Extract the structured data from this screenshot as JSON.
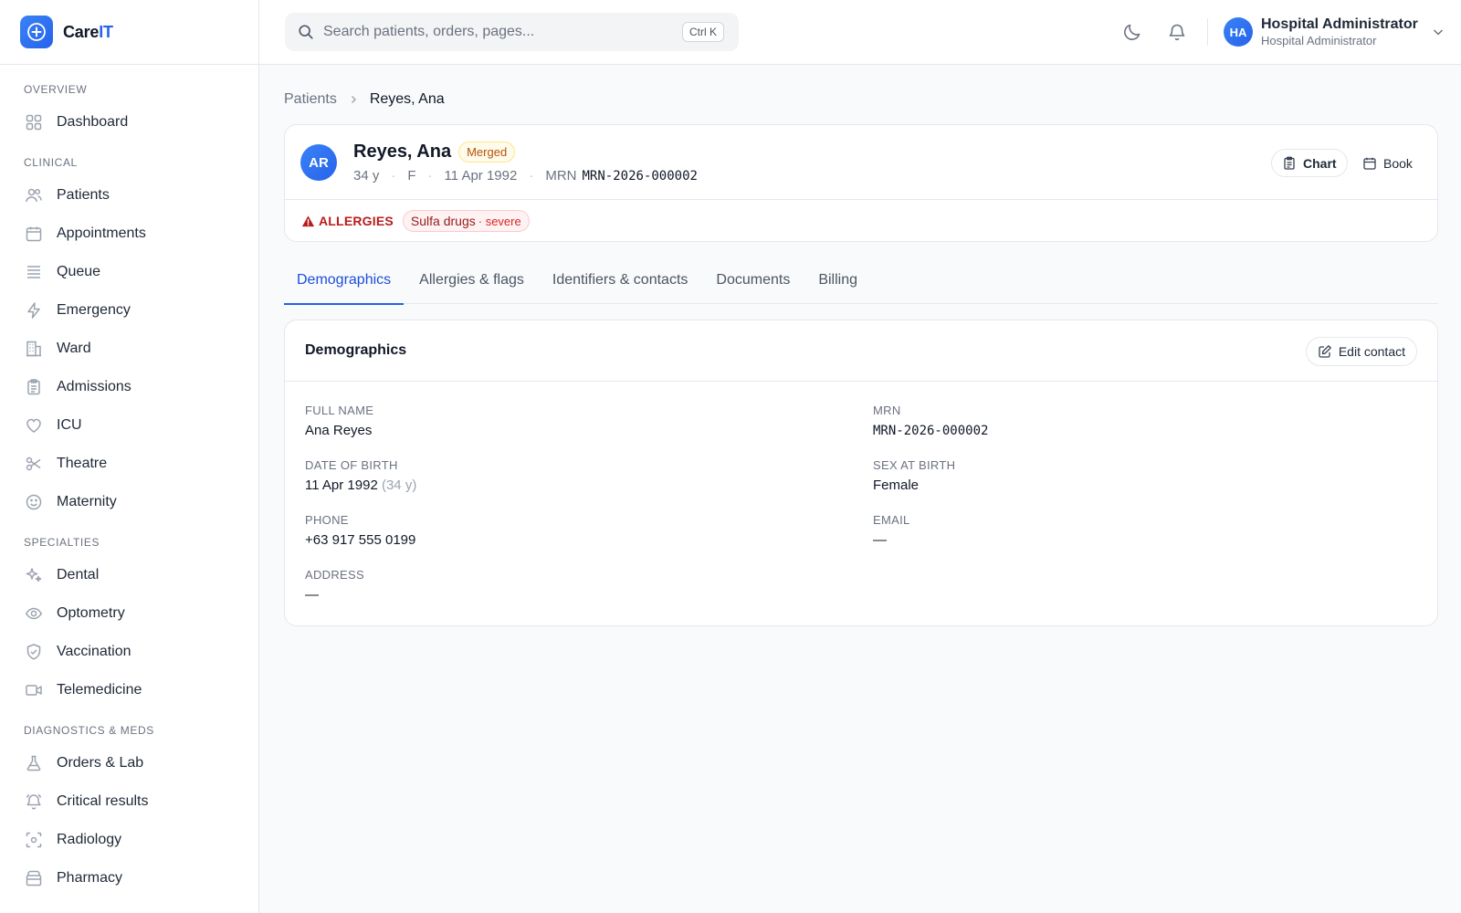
{
  "app": {
    "name_main": "Care",
    "name_accent": "IT"
  },
  "search": {
    "placeholder": "Search patients, orders, pages...",
    "shortcut": "Ctrl K"
  },
  "user": {
    "name": "Hospital Administrator",
    "role": "Hospital Administrator",
    "initials": "HA"
  },
  "sidebar": {
    "sections": [
      {
        "heading": "OVERVIEW",
        "items": [
          {
            "label": "Dashboard",
            "icon": "grid-icon"
          }
        ]
      },
      {
        "heading": "CLINICAL",
        "items": [
          {
            "label": "Patients",
            "icon": "users-icon"
          },
          {
            "label": "Appointments",
            "icon": "calendar-icon"
          },
          {
            "label": "Queue",
            "icon": "list-icon"
          },
          {
            "label": "Emergency",
            "icon": "bolt-icon"
          },
          {
            "label": "Ward",
            "icon": "building-icon"
          },
          {
            "label": "Admissions",
            "icon": "clipboard-icon"
          },
          {
            "label": "ICU",
            "icon": "heart-icon"
          },
          {
            "label": "Theatre",
            "icon": "scissors-icon"
          },
          {
            "label": "Maternity",
            "icon": "smile-icon"
          }
        ]
      },
      {
        "heading": "SPECIALTIES",
        "items": [
          {
            "label": "Dental",
            "icon": "sparkles-icon"
          },
          {
            "label": "Optometry",
            "icon": "eye-icon"
          },
          {
            "label": "Vaccination",
            "icon": "shield-check-icon"
          },
          {
            "label": "Telemedicine",
            "icon": "video-icon"
          }
        ]
      },
      {
        "heading": "DIAGNOSTICS & MEDS",
        "items": [
          {
            "label": "Orders & Lab",
            "icon": "flask-icon"
          },
          {
            "label": "Critical results",
            "icon": "bell-alert-icon"
          },
          {
            "label": "Radiology",
            "icon": "scan-icon"
          },
          {
            "label": "Pharmacy",
            "icon": "pill-box-icon"
          }
        ]
      }
    ]
  },
  "breadcrumb": {
    "parent": "Patients",
    "current": "Reyes, Ana"
  },
  "patient": {
    "name": "Reyes, Ana",
    "initials": "AR",
    "status_badge": "Merged",
    "age": "34 y",
    "sex": "F",
    "dob": "11 Apr 1992",
    "mrn_label": "MRN",
    "mrn": "MRN-2026-000002",
    "actions": {
      "chart": "Chart",
      "book": "Book"
    },
    "allergies_label": "ALLERGIES",
    "allergies": [
      {
        "name": "Sulfa drugs",
        "severity": "· severe"
      }
    ]
  },
  "tabs": [
    {
      "label": "Demographics",
      "active": true
    },
    {
      "label": "Allergies & flags",
      "active": false
    },
    {
      "label": "Identifiers & contacts",
      "active": false
    },
    {
      "label": "Documents",
      "active": false
    },
    {
      "label": "Billing",
      "active": false
    }
  ],
  "demographics": {
    "title": "Demographics",
    "edit_label": "Edit contact",
    "full_name": {
      "label": "FULL NAME",
      "value": "Ana Reyes"
    },
    "mrn": {
      "label": "MRN",
      "value": "MRN-2026-000002"
    },
    "dob": {
      "label": "DATE OF BIRTH",
      "value": "11 Apr 1992",
      "age_note": "(34 y)"
    },
    "sex": {
      "label": "SEX AT BIRTH",
      "value": "Female"
    },
    "phone": {
      "label": "PHONE",
      "value": "+63 917 555 0199"
    },
    "email": {
      "label": "EMAIL",
      "value": "—"
    },
    "address": {
      "label": "ADDRESS",
      "value": "—"
    }
  },
  "colors": {
    "accent": "#2563eb",
    "allergy": "#b91c1c",
    "badge_merged": "#b45309"
  }
}
